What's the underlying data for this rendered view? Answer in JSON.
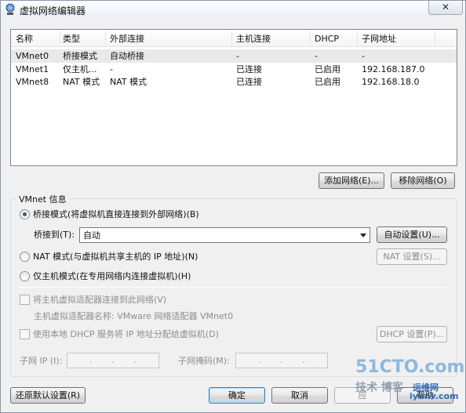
{
  "window": {
    "title": "虚拟网络编辑器",
    "close_glyph": "✕"
  },
  "table": {
    "headers": [
      "名称",
      "类型",
      "外部连接",
      "主机连接",
      "DHCP",
      "子网地址"
    ],
    "rows": [
      [
        "VMnet0",
        "桥接模式",
        "自动桥接",
        "-",
        "-",
        "-"
      ],
      [
        "VMnet1",
        "仅主机...",
        "-",
        "已连接",
        "已启用",
        "192.168.187.0"
      ],
      [
        "VMnet8",
        "NAT 模式",
        "NAT 模式",
        "已连接",
        "已启用",
        "192.168.18.0"
      ]
    ]
  },
  "buttons": {
    "add_network": "添加网络(E)...",
    "remove_network": "移除网络(O)",
    "auto_settings": "自动设置(U)...",
    "nat_settings": "NAT 设置(S)...",
    "dhcp_settings": "DHCP 设置(P)...",
    "restore_defaults": "还原默认设置(R)",
    "ok": "确定",
    "cancel": "取消",
    "apply": "应",
    "help": "帮助"
  },
  "vmnet_info": {
    "group_label": "VMnet 信息",
    "bridged_radio": "桥接模式(将虚拟机直接连接到外部网络)(B)",
    "bridge_to_label": "桥接到(T):",
    "bridge_to_value": "自动",
    "nat_radio": "NAT 模式(与虚拟机共享主机的 IP 地址)(N)",
    "hostonly_radio": "仅主机模式(在专用网络内连接虚拟机)(H)",
    "connect_adapter_check": "将主机虚拟适配器连接到此网络(V)",
    "adapter_name_text": "主机虚拟适配器名称: VMware 网络适配器 VMnet0",
    "dhcp_check": "使用本地 DHCP 服务将 IP 地址分配给虚拟机(D)",
    "subnet_ip_label": "子网 IP (I):",
    "subnet_mask_label": "子网掩码(M):",
    "ip_dots": ".",
    "selected_mode": "bridged"
  },
  "watermark": {
    "big": "51CTO.com",
    "small": "技术 博客",
    "blue": "运维网",
    "url": "iyunv.com"
  },
  "colors": {
    "accent": "#2a5c9a",
    "selected_row": "#e9e9e9",
    "window_bg": "#f0f0f0"
  },
  "icons": {
    "app": "network-globe-icon",
    "close": "close-icon",
    "dropdown": "chevron-down-icon"
  }
}
